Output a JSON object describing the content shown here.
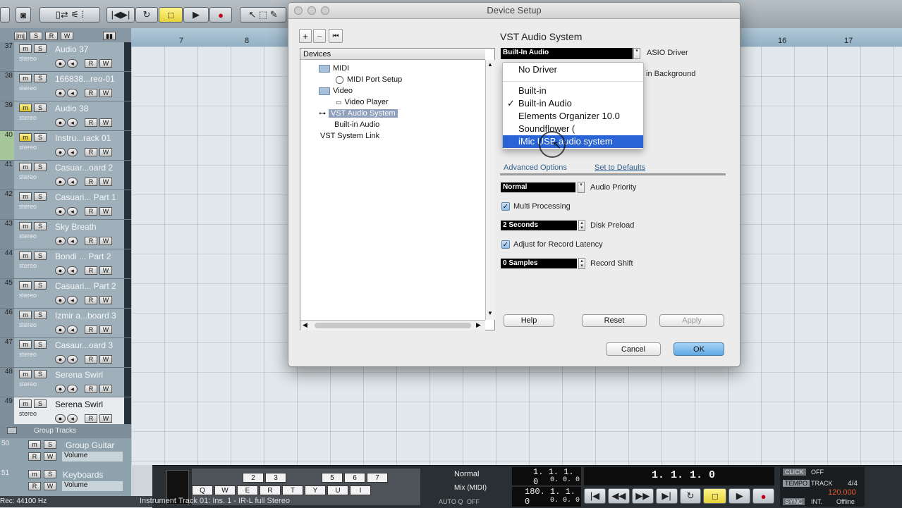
{
  "ruler": {
    "marks": [
      "7",
      "8",
      "16",
      "17"
    ]
  },
  "tracks": [
    {
      "num": "37",
      "name": "Audio 37",
      "sub": "stereo"
    },
    {
      "num": "38",
      "name": "166838...reo-01",
      "sub": "stereo"
    },
    {
      "num": "39",
      "name": "Audio 38",
      "sub": "stereo"
    },
    {
      "num": "40",
      "name": "Instru...rack 01",
      "sub": "stereo"
    },
    {
      "num": "41",
      "name": "Casuar...oard 2",
      "sub": "stereo"
    },
    {
      "num": "42",
      "name": "Casuari... Part 1",
      "sub": "stereo"
    },
    {
      "num": "43",
      "name": "Sky Breath",
      "sub": "stereo"
    },
    {
      "num": "44",
      "name": "Bondi ... Part 2",
      "sub": "stereo"
    },
    {
      "num": "45",
      "name": "Casuari... Part 2",
      "sub": "stereo"
    },
    {
      "num": "46",
      "name": "Izmir a...board 3",
      "sub": "stereo"
    },
    {
      "num": "47",
      "name": "Casaur...oard 3",
      "sub": "stereo"
    },
    {
      "num": "48",
      "name": "Serena Swirl",
      "sub": "stereo"
    },
    {
      "num": "49",
      "name": "Serena Swirl",
      "sub": "stereo"
    }
  ],
  "group_tracks": {
    "folder_label": "Group Tracks",
    "items": [
      {
        "num": "50",
        "name": "Group Guitar",
        "param": "Volume"
      },
      {
        "num": "51",
        "name": "Keyboards",
        "param": "Volume"
      }
    ]
  },
  "track_buttons": {
    "mute": "m",
    "solo": "S",
    "read": "R",
    "write": "W"
  },
  "dialog": {
    "title": "Device Setup",
    "toolbar": {
      "add": "+",
      "remove": "−",
      "reset": "⏮"
    },
    "devices_header": "Devices",
    "tree": [
      {
        "label": "MIDI",
        "type": "folder"
      },
      {
        "label": "MIDI Port Setup",
        "type": "child"
      },
      {
        "label": "Video",
        "type": "folder"
      },
      {
        "label": "Video Player",
        "type": "child"
      },
      {
        "label": "VST Audio System",
        "type": "selected"
      },
      {
        "label": "Built-in Audio",
        "type": "child"
      },
      {
        "label": "VST System Link",
        "type": "plain"
      }
    ],
    "panel_title": "VST Audio System",
    "asio_driver_value": "Built-In Audio",
    "asio_driver_label": "ASIO Driver",
    "background_label": "in Background",
    "advanced_tab": "Advanced Options",
    "defaults_link": "Set to Defaults",
    "audio_priority_value": "Normal",
    "audio_priority_label": "Audio Priority",
    "multi_processing_label": "Multi Processing",
    "disk_preload_value": "2 Seconds",
    "disk_preload_label": "Disk Preload",
    "record_latency_label": "Adjust for Record Latency",
    "record_shift_value": "0 Samples",
    "record_shift_label": "Record Shift",
    "help_button": "Help",
    "reset_button": "Reset",
    "apply_button": "Apply",
    "cancel_button": "Cancel",
    "ok_button": "OK"
  },
  "driver_menu": {
    "items": [
      {
        "label": "No Driver",
        "checked": false
      },
      {
        "label": "Built-in",
        "checked": false
      },
      {
        "label": "Built-in Audio",
        "checked": true
      },
      {
        "label": "Elements Organizer 10.0",
        "checked": false
      },
      {
        "label": "Soundflower (",
        "checked": false
      },
      {
        "label": "iMic USB audio system",
        "checked": false
      }
    ],
    "checkmark": "✓"
  },
  "transport": {
    "keys_top": [
      "2",
      "3",
      "5",
      "6",
      "7"
    ],
    "keys_bottom": [
      "Q",
      "W",
      "E",
      "R",
      "T",
      "Y",
      "U",
      "I"
    ],
    "mode_label": "Normal",
    "mix_label": "Mix (MIDI)",
    "auto_label": "AUTO Q",
    "auto_value": "OFF",
    "left_locator": "1. 1. 1.   0",
    "right_locator": "180. 1. 1.   0",
    "loc_small_1": "0. 0. 0",
    "loc_small_2": "0. 0. 0",
    "position": "1. 1. 1.   0",
    "click_label": "CLICK",
    "click_value": "OFF",
    "tempo_label": "TEMPO",
    "track_label": "TRACK",
    "signature": "4/4",
    "tempo_value": "120.000",
    "sync_label": "SYNC",
    "sync_int": "INT.",
    "sync_value": "Offline"
  },
  "status": {
    "rec_rate": "Rec: 44100 Hz",
    "message": "Instrument Track 01: Ins. 1 - IR-L full Stereo"
  },
  "colors": {
    "menu_highlight": "#2a64d4",
    "selected_tree": "#8ea0bb",
    "ok_button": "#5fa9e5",
    "record": "#c0001a"
  }
}
